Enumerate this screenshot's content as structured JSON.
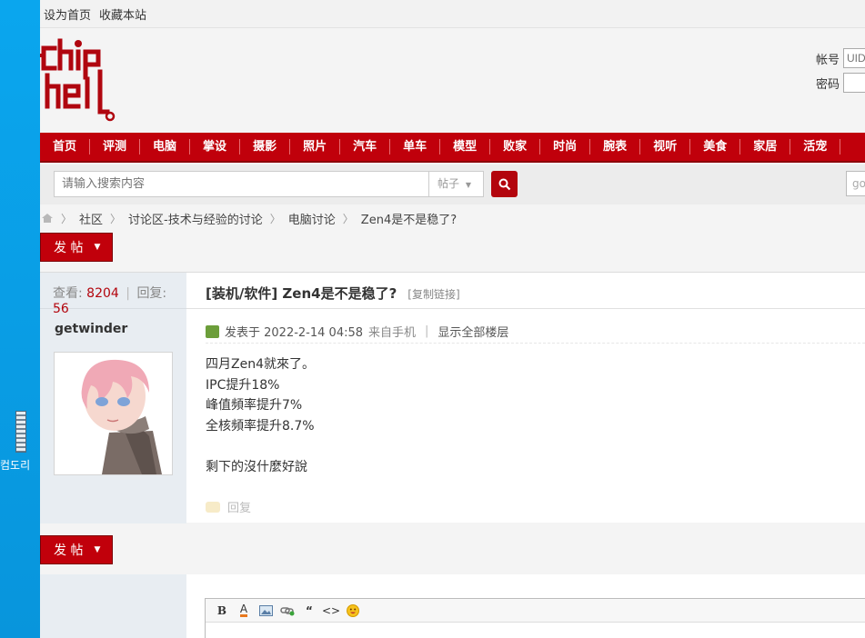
{
  "desktop": {
    "icon_label": "컴도리"
  },
  "topbar": {
    "set_home": "设为首页",
    "bookmark": "收藏本站"
  },
  "login": {
    "account_label": "帐号",
    "account_placeholder": "UID",
    "password_label": "密码"
  },
  "nav": {
    "items": [
      "首页",
      "评测",
      "电脑",
      "掌设",
      "摄影",
      "照片",
      "汽车",
      "单车",
      "模型",
      "败家",
      "时尚",
      "腕表",
      "视听",
      "美食",
      "家居",
      "活宠"
    ]
  },
  "search": {
    "placeholder": "请输入搜索内容",
    "type": "帖子",
    "right_box": "go"
  },
  "breadcrumb": {
    "items": [
      "社区",
      "讨论区-技术与经验的讨论",
      "电脑讨论",
      "Zen4是不是稳了?"
    ]
  },
  "post_button": {
    "label": "发 帖"
  },
  "thread": {
    "views_label": "查看:",
    "views": "8204",
    "replies_label": "回复:",
    "replies": "56",
    "author": "getwinder",
    "title": "[装机/软件] Zen4是不是稳了?",
    "copy_link": "[复制链接]",
    "posted": "发表于 2022-2-14 04:58",
    "source": "来自手机",
    "show_all": "显示全部楼层",
    "content": [
      "四月Zen4就來了。",
      "IPC提升18%",
      "峰值頻率提升7%",
      "全核頻率提升8.7%",
      "",
      "剩下的沒什麼好說"
    ],
    "reply_label": "回复"
  },
  "editor": {
    "tools": [
      "B",
      "A",
      "image-icon",
      "link-icon",
      "“",
      "<>",
      "smiley-icon"
    ]
  },
  "colors": {
    "nav_red": "#c0000b",
    "accent_num": "#b3050d",
    "side_bg": "#e8edf2"
  }
}
